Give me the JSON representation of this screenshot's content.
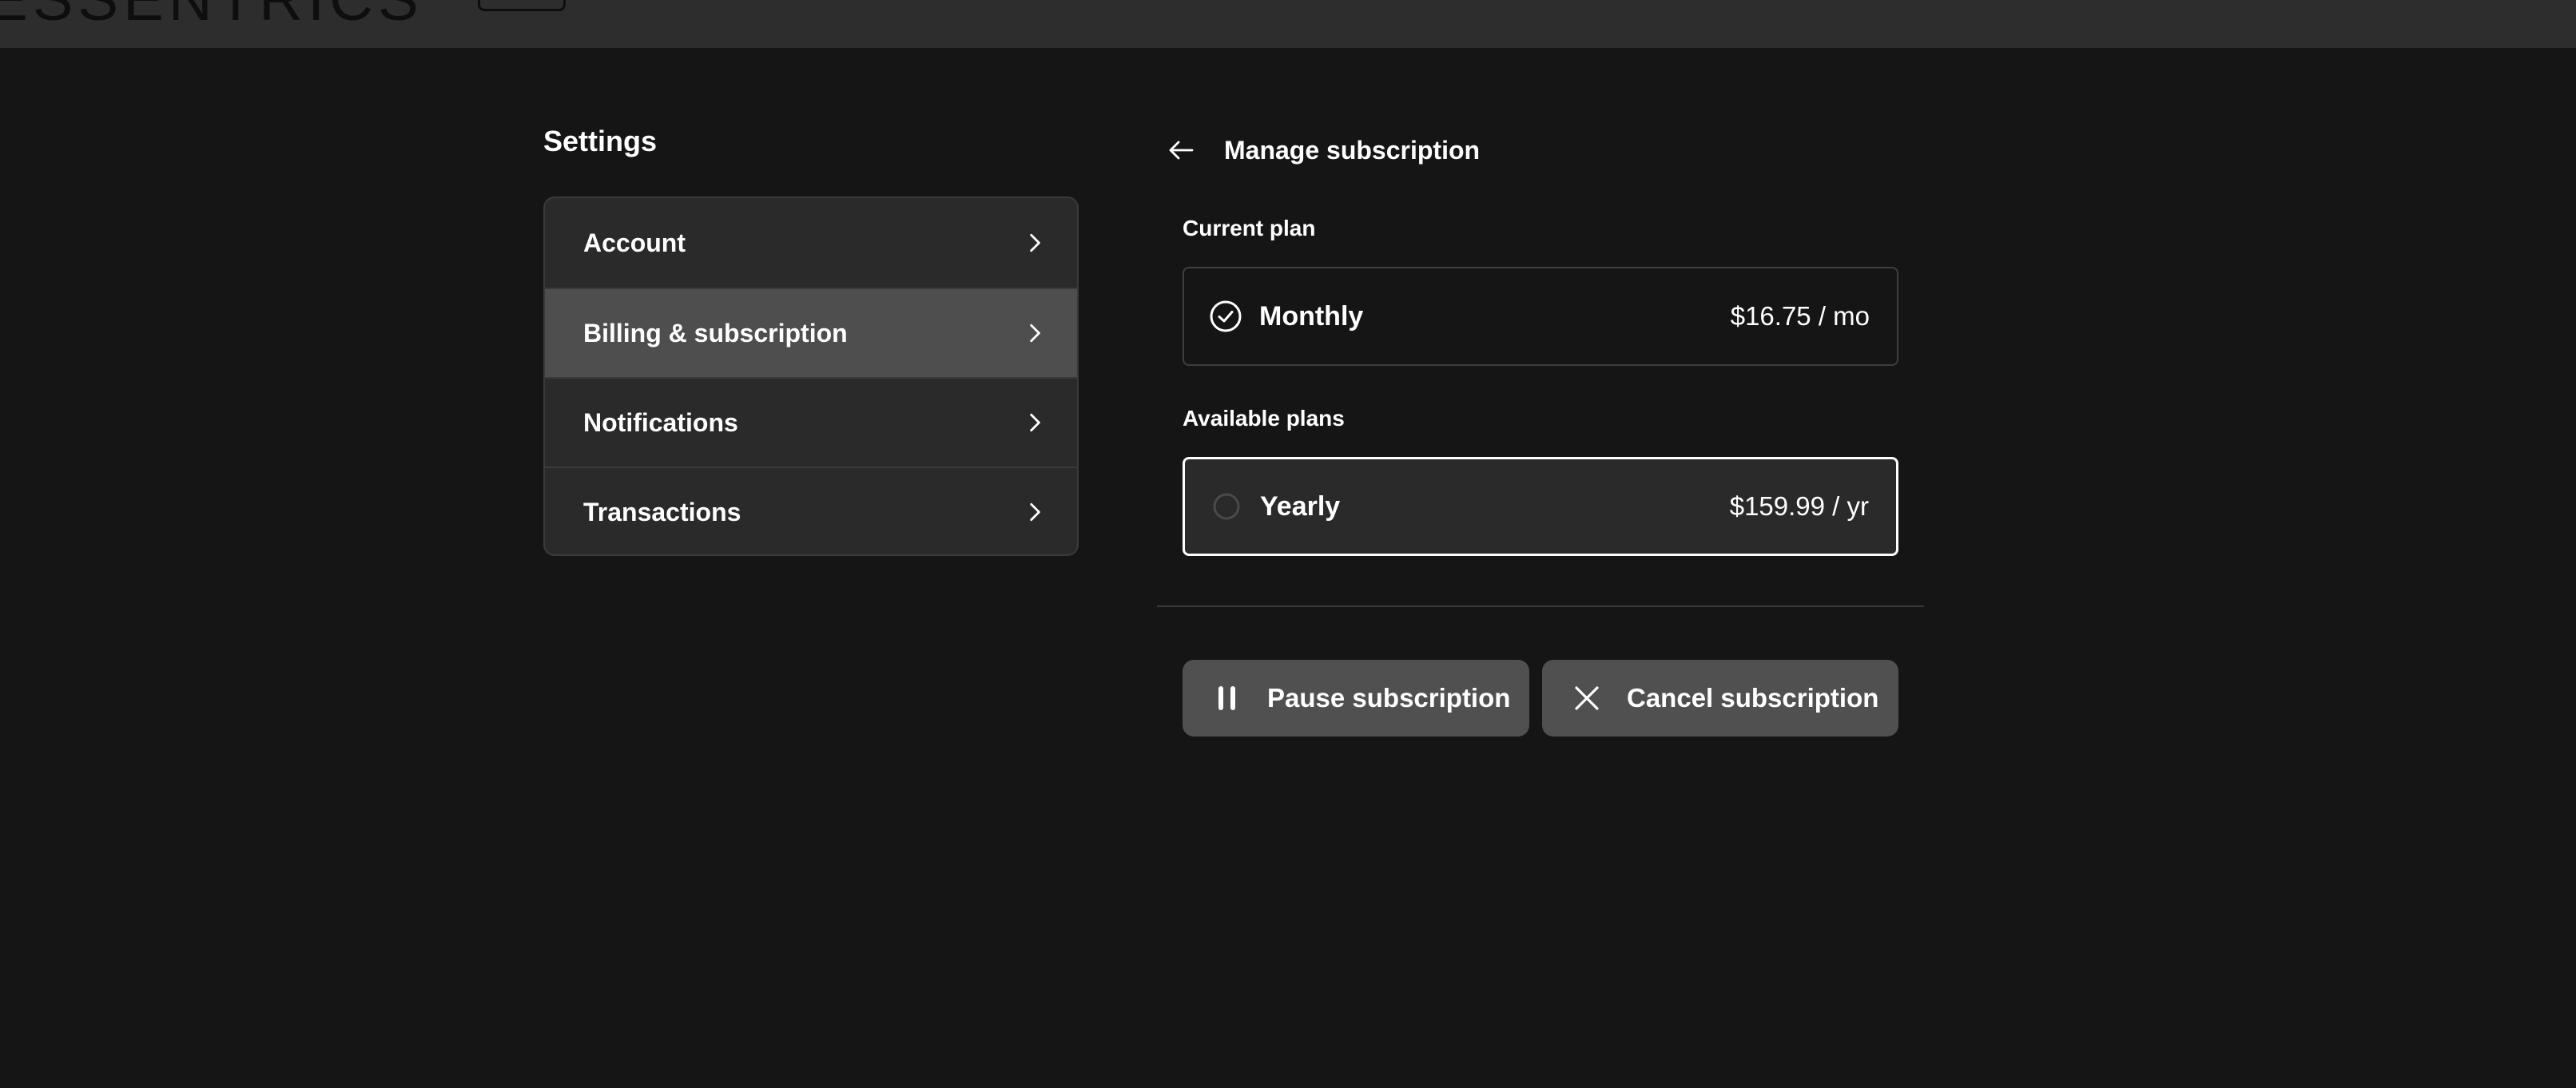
{
  "header": {
    "logo_text": "ESSENTRICS"
  },
  "settings": {
    "title": "Settings",
    "menu": [
      {
        "label": "Account",
        "active": false
      },
      {
        "label": "Billing & subscription",
        "active": true
      },
      {
        "label": "Notifications",
        "active": false
      },
      {
        "label": "Transactions",
        "active": false
      }
    ]
  },
  "subscription": {
    "title": "Manage subscription",
    "back_icon": "arrow-left-icon",
    "current_plan_label": "Current plan",
    "current_plan": {
      "name": "Monthly",
      "price": "$16.75 / mo",
      "icon": "check-circle-icon"
    },
    "available_plans_label": "Available plans",
    "available_plans": [
      {
        "name": "Yearly",
        "price": "$159.99 / yr",
        "selected": false
      }
    ],
    "actions": {
      "pause_label": "Pause subscription",
      "pause_icon": "pause-icon",
      "cancel_label": "Cancel subscription",
      "cancel_icon": "close-icon"
    }
  },
  "colors": {
    "background": "#151515",
    "topbar": "#2d2d2d",
    "menu_bg": "#2a2a2a",
    "menu_active": "#4e4e4e",
    "button_bg": "#505050",
    "text": "#ffffff"
  }
}
